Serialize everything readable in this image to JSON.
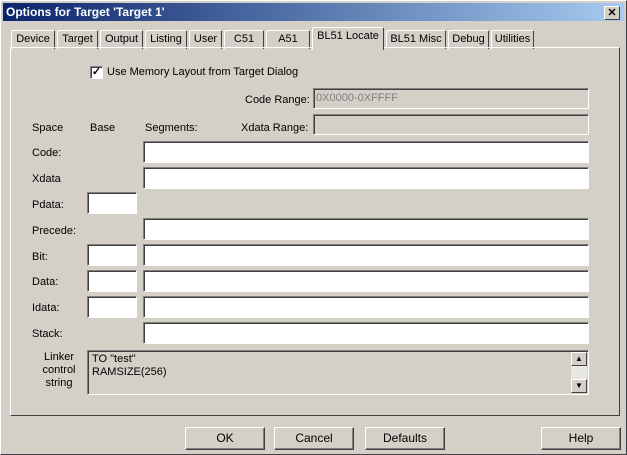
{
  "window": {
    "title": "Options for Target 'Target 1'",
    "close_glyph": "✕"
  },
  "tabs": [
    {
      "label": "Device"
    },
    {
      "label": "Target"
    },
    {
      "label": "Output"
    },
    {
      "label": "Listing"
    },
    {
      "label": "User"
    },
    {
      "label": "C51"
    },
    {
      "label": "A51"
    },
    {
      "label": "BL51 Locate",
      "active": true
    },
    {
      "label": "BL51 Misc"
    },
    {
      "label": "Debug"
    },
    {
      "label": "Utilities"
    }
  ],
  "form": {
    "use_memory_layout": {
      "label": "Use Memory Layout from Target Dialog",
      "checked": true,
      "glyph": "✓"
    },
    "code_range": {
      "label": "Code Range:",
      "value": "0X0000-0XFFFF"
    },
    "xdata_range": {
      "label": "Xdata Range:",
      "value": ""
    },
    "headers": {
      "space": "Space",
      "base": "Base",
      "segments": "Segments:"
    },
    "rows": {
      "code": {
        "label": "Code:",
        "base": "",
        "segments": ""
      },
      "xdata": {
        "label": "Xdata",
        "base": "",
        "segments": ""
      },
      "pdata": {
        "label": "Pdata:",
        "base": ""
      },
      "precede": {
        "label": "Precede:",
        "segments": ""
      },
      "bit": {
        "label": "Bit:",
        "base": "",
        "segments": ""
      },
      "data": {
        "label": "Data:",
        "base": "",
        "segments": ""
      },
      "idata": {
        "label": "Idata:",
        "base": "",
        "segments": ""
      },
      "stack": {
        "label": "Stack:",
        "segments": ""
      }
    },
    "linker_control": {
      "label_line1": "Linker",
      "label_line2": "control",
      "label_line3": "string",
      "line1": "TO \"test\"",
      "line2": "RAMSIZE(256)"
    }
  },
  "buttons": {
    "ok": "OK",
    "cancel": "Cancel",
    "defaults": "Defaults",
    "help": "Help"
  }
}
